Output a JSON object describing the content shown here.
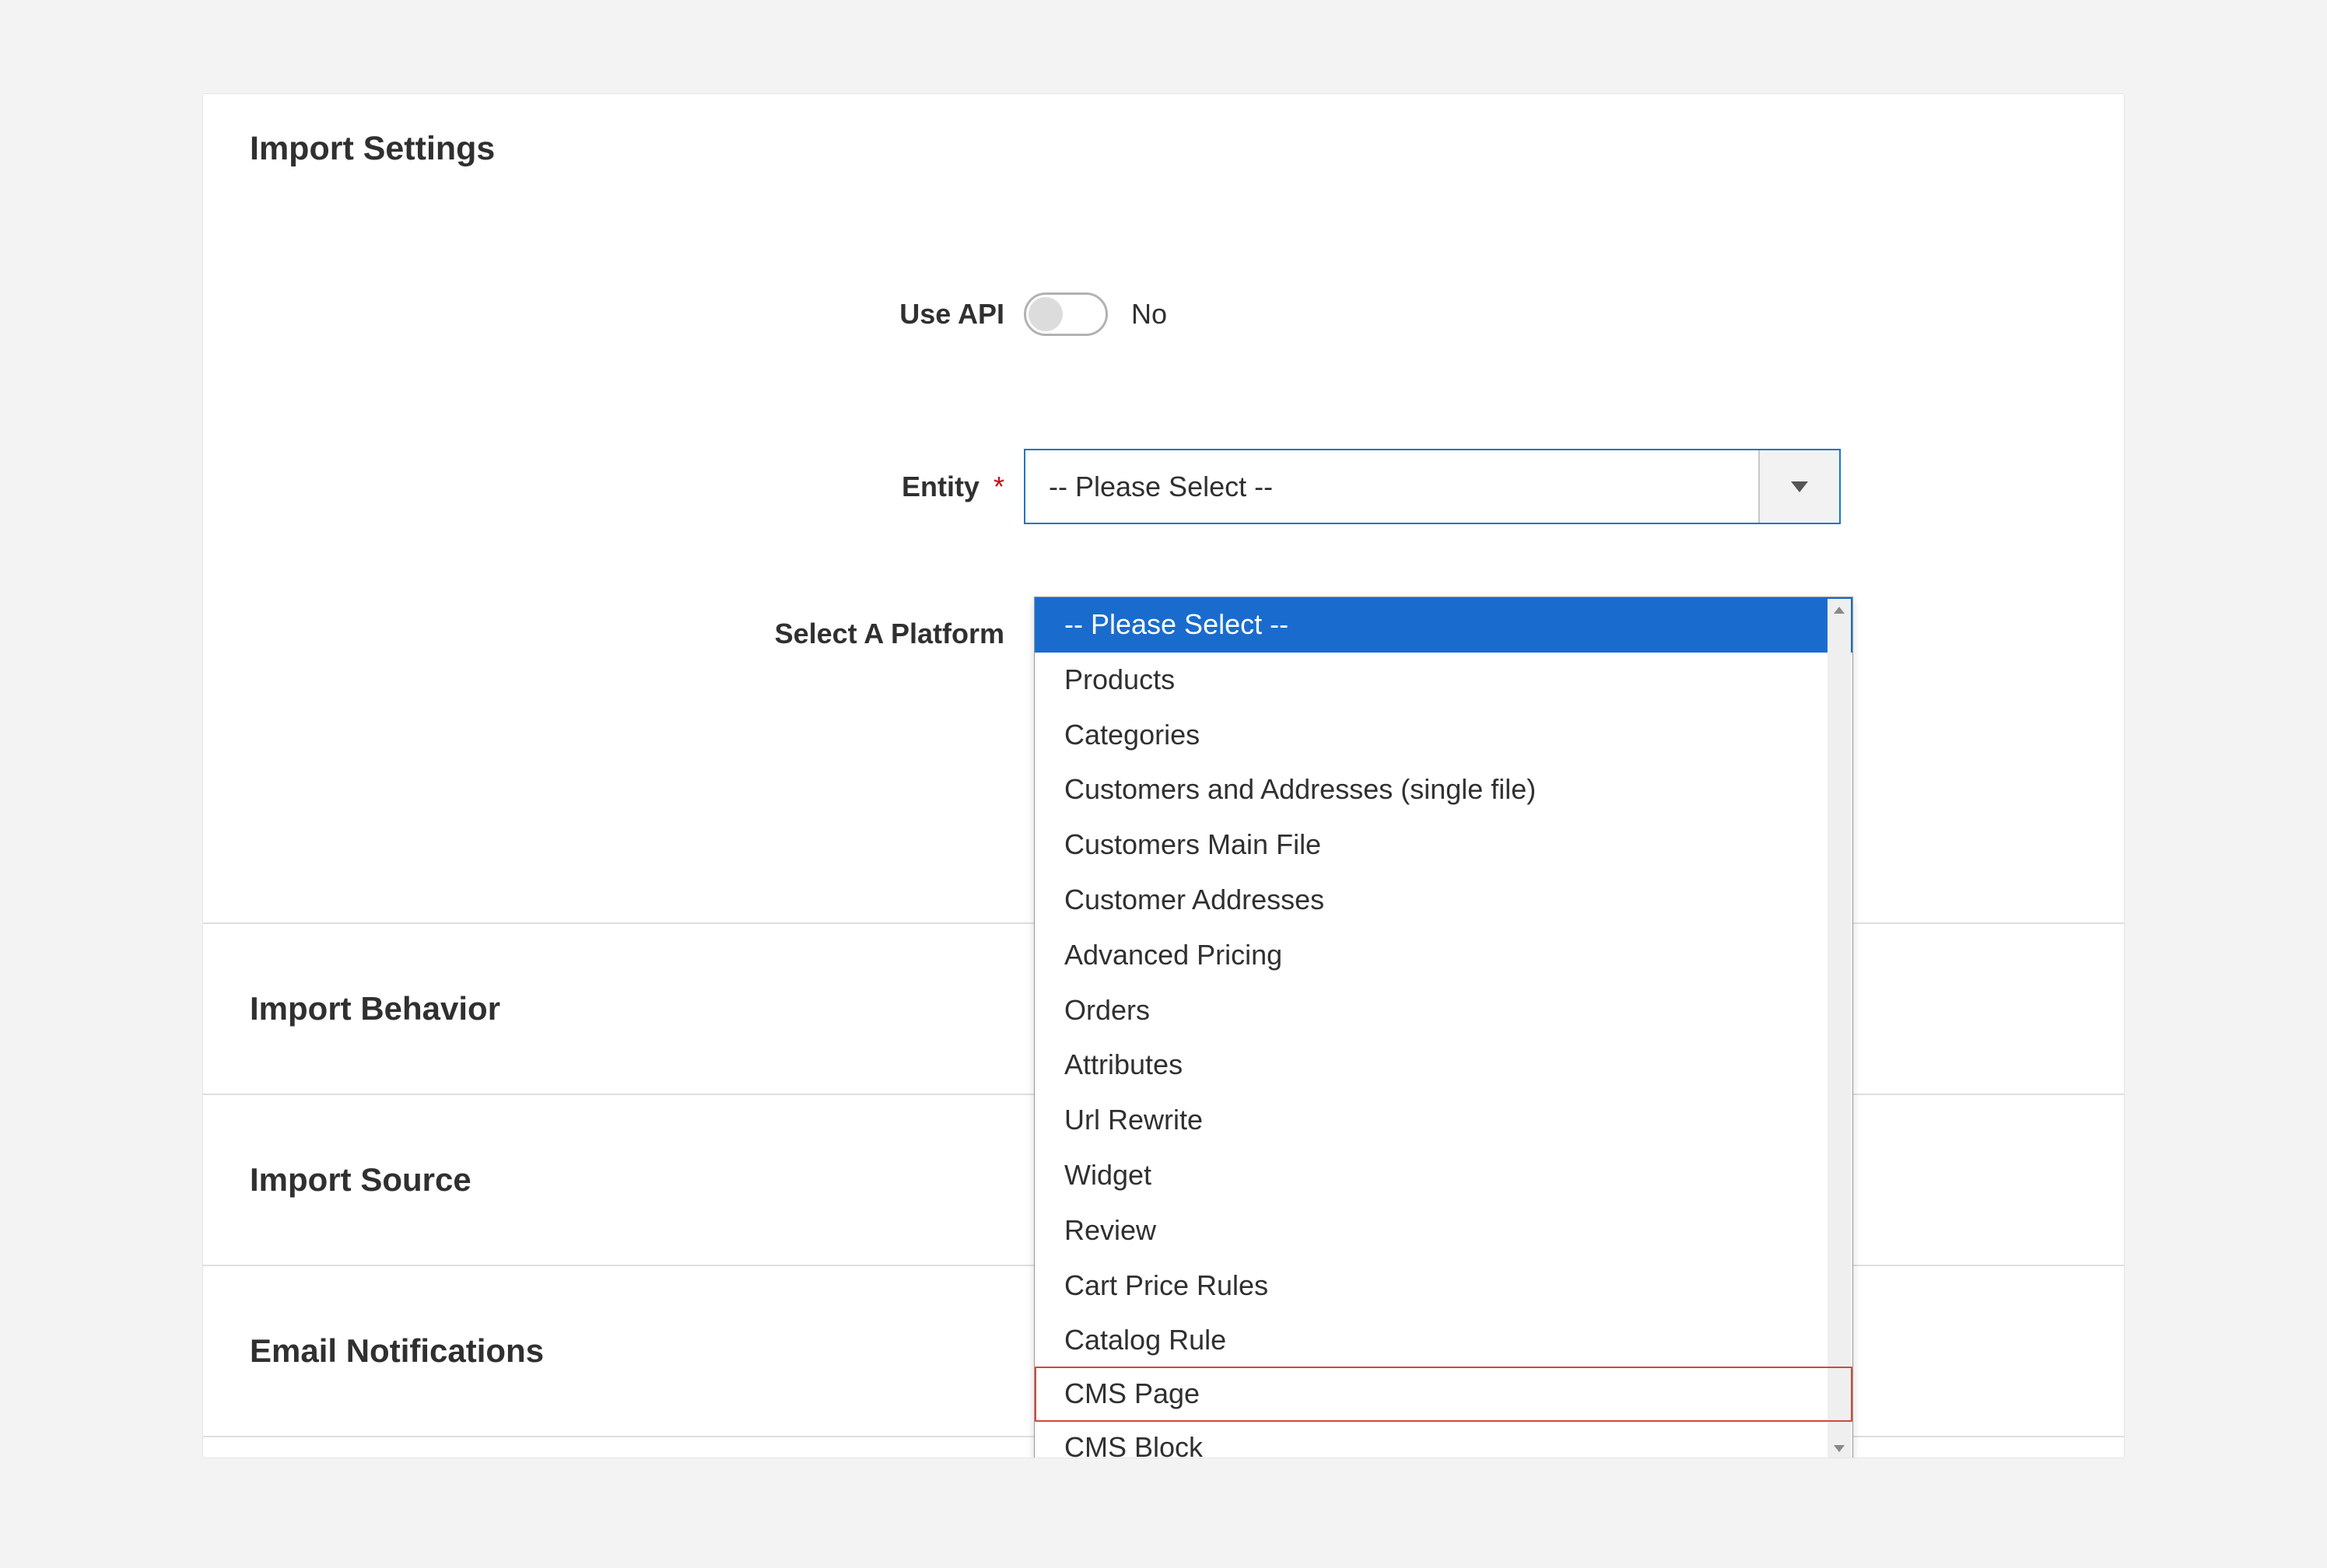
{
  "panel": {
    "title": "Import Settings",
    "fields": {
      "use_api": {
        "label": "Use API",
        "value_text": "No"
      },
      "entity": {
        "label": "Entity",
        "required_mark": "*",
        "selected": "-- Please Select --",
        "options": [
          "-- Please Select --",
          "Products",
          "Categories",
          "Customers and Addresses (single file)",
          "Customers Main File",
          "Customer Addresses",
          "Advanced Pricing",
          "Orders",
          "Attributes",
          "Url Rewrite",
          "Widget",
          "Review",
          "Cart Price Rules",
          "Catalog Rule",
          "CMS Page",
          "CMS Block"
        ],
        "highlighted_option": "CMS Page"
      },
      "platform": {
        "label": "Select A Platform"
      }
    },
    "sections": [
      "Import Behavior",
      "Import Source",
      "Email Notifications"
    ]
  }
}
